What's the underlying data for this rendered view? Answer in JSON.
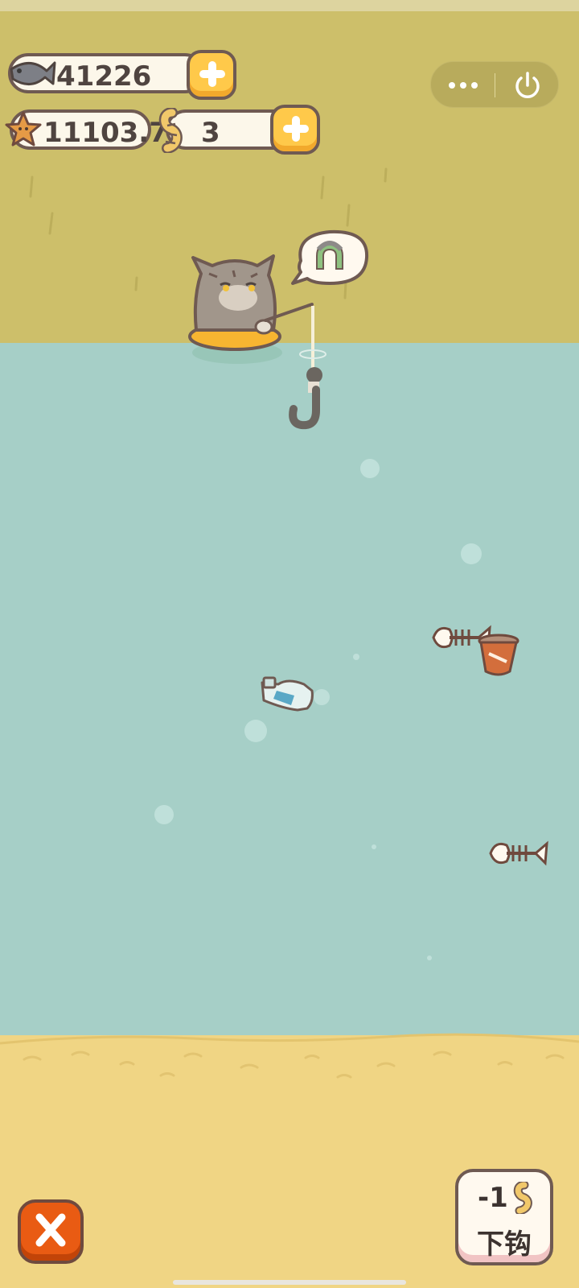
{
  "currencies": {
    "fish": {
      "value": "41226"
    },
    "starfish": {
      "value": "11103.7"
    },
    "worms": {
      "value": "3"
    }
  },
  "icons": {
    "fish": "fish-icon",
    "starfish": "starfish-icon",
    "worm": "worm-icon",
    "add": "plus-icon",
    "more": "more-dots-icon",
    "power": "power-icon",
    "close": "close-icon",
    "horseshoe": "horseshoe-icon"
  },
  "controls": {
    "hook_cost": "-1",
    "hook_label": "下钩"
  },
  "colors": {
    "sky": "#cdbf6a",
    "water": "#a6cfc7",
    "sand": "#f0d584",
    "accent_button": "#ffc94a",
    "close_button": "#e95b13"
  }
}
